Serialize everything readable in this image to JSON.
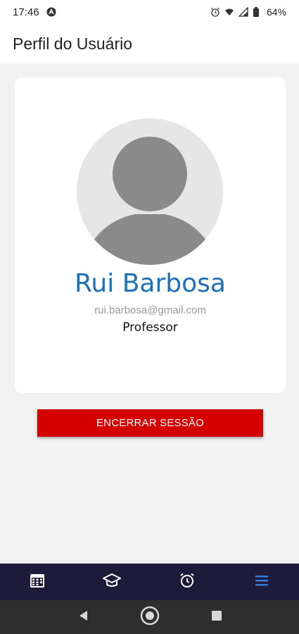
{
  "status_bar": {
    "time": "17:46",
    "battery": "64%",
    "icons": [
      "notification-a-icon",
      "alarm-icon",
      "wifi-icon",
      "signal-icon",
      "battery-icon"
    ]
  },
  "header": {
    "title": "Perfil do Usuário"
  },
  "profile": {
    "name": "Rui Barbosa",
    "email": "rui.barbosa@gmail.com",
    "role": "Professor",
    "avatar_icon": "default-avatar-icon"
  },
  "actions": {
    "logout_label": "ENCERRAR SESSÃO"
  },
  "bottom_nav": {
    "items": [
      {
        "icon": "calendar-icon"
      },
      {
        "icon": "graduation-cap-icon"
      },
      {
        "icon": "alarm-clock-icon"
      },
      {
        "icon": "menu-icon",
        "active": true
      }
    ]
  },
  "colors": {
    "accent": "#1d6fb8",
    "logout": "#d40000",
    "nav_bg": "#1e1b3a",
    "nav_active": "#2f7de0"
  }
}
